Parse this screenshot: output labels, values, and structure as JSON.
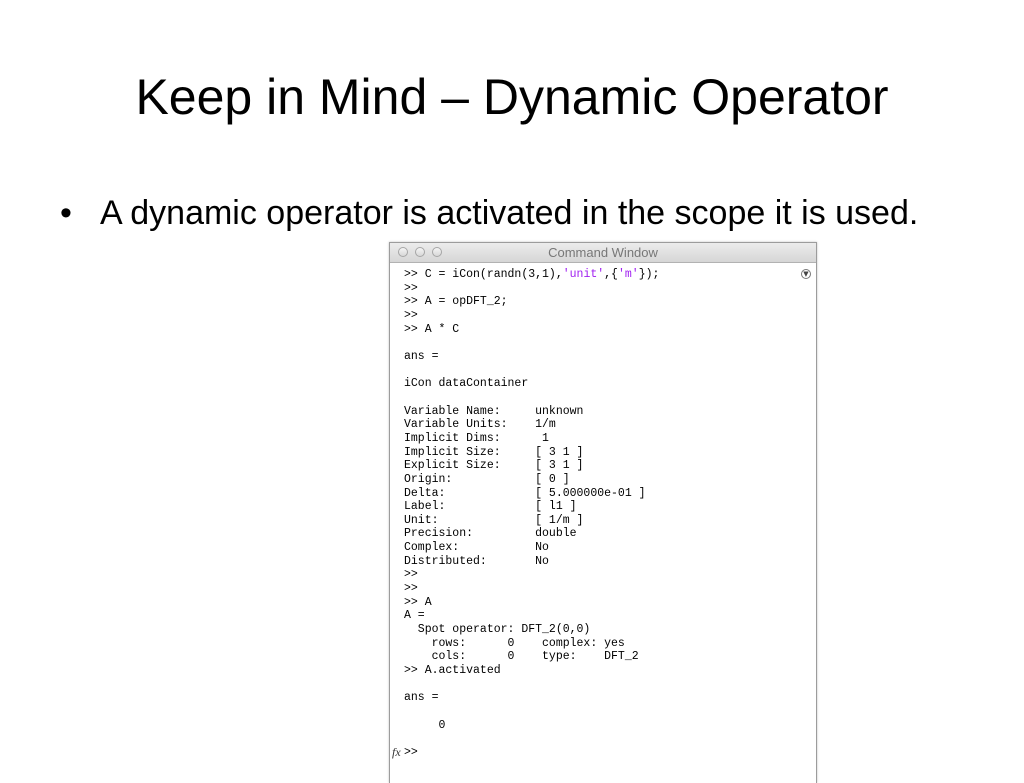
{
  "slide": {
    "title": "Keep in Mind – Dynamic Operator",
    "bullet_symbol": "•",
    "bullets": [
      "A dynamic operator is activated in the scope it is used."
    ]
  },
  "command_window": {
    "title": "Command Window",
    "fx_label": "fx",
    "lines": [
      ">> C = iCon(randn(3,1),",
      ">>",
      ">> A = opDFT_2;",
      ">>",
      ">> A * C",
      "",
      "ans =",
      "",
      "iCon dataContainer",
      "",
      "Variable Name:     unknown",
      "Variable Units:    1/m",
      "Implicit Dims:      1",
      "Implicit Size:     [ 3 1 ]",
      "Explicit Size:     [ 3 1 ]",
      "Origin:            [ 0 ]",
      "Delta:             [ 5.000000e-01 ]",
      "Label:             [ l1 ]",
      "Unit:              [ 1/m ]",
      "Precision:         double",
      "Complex:           No",
      "Distributed:       No",
      ">>",
      ">>",
      ">> A",
      "A =",
      "  Spot operator: DFT_2(0,0)",
      "    rows:      0    complex: yes",
      "    cols:      0    type:    DFT_2",
      ">> A.activated",
      "",
      "ans =",
      "",
      "     0",
      "",
      ">>"
    ],
    "first_line_tail": {
      "str1": "'unit'",
      "sep": ",{",
      "str2": "'m'",
      "end": "});"
    }
  },
  "colors": {
    "string_literal": "#a020f0",
    "text": "#000000"
  }
}
